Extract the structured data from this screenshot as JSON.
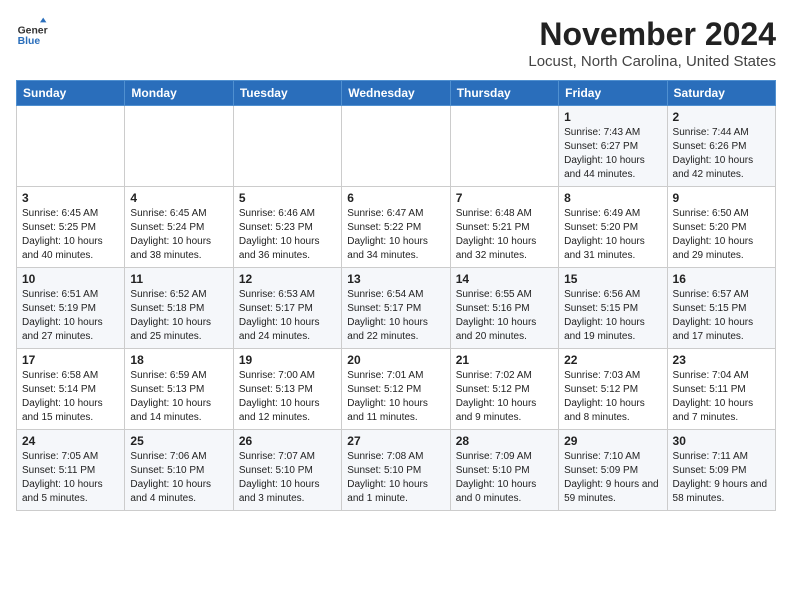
{
  "header": {
    "logo_line1": "General",
    "logo_line2": "Blue",
    "title": "November 2024",
    "subtitle": "Locust, North Carolina, United States"
  },
  "calendar": {
    "days_of_week": [
      "Sunday",
      "Monday",
      "Tuesday",
      "Wednesday",
      "Thursday",
      "Friday",
      "Saturday"
    ],
    "weeks": [
      [
        {
          "day": "",
          "detail": ""
        },
        {
          "day": "",
          "detail": ""
        },
        {
          "day": "",
          "detail": ""
        },
        {
          "day": "",
          "detail": ""
        },
        {
          "day": "",
          "detail": ""
        },
        {
          "day": "1",
          "detail": "Sunrise: 7:43 AM\nSunset: 6:27 PM\nDaylight: 10 hours and 44 minutes."
        },
        {
          "day": "2",
          "detail": "Sunrise: 7:44 AM\nSunset: 6:26 PM\nDaylight: 10 hours and 42 minutes."
        }
      ],
      [
        {
          "day": "3",
          "detail": "Sunrise: 6:45 AM\nSunset: 5:25 PM\nDaylight: 10 hours and 40 minutes."
        },
        {
          "day": "4",
          "detail": "Sunrise: 6:45 AM\nSunset: 5:24 PM\nDaylight: 10 hours and 38 minutes."
        },
        {
          "day": "5",
          "detail": "Sunrise: 6:46 AM\nSunset: 5:23 PM\nDaylight: 10 hours and 36 minutes."
        },
        {
          "day": "6",
          "detail": "Sunrise: 6:47 AM\nSunset: 5:22 PM\nDaylight: 10 hours and 34 minutes."
        },
        {
          "day": "7",
          "detail": "Sunrise: 6:48 AM\nSunset: 5:21 PM\nDaylight: 10 hours and 32 minutes."
        },
        {
          "day": "8",
          "detail": "Sunrise: 6:49 AM\nSunset: 5:20 PM\nDaylight: 10 hours and 31 minutes."
        },
        {
          "day": "9",
          "detail": "Sunrise: 6:50 AM\nSunset: 5:20 PM\nDaylight: 10 hours and 29 minutes."
        }
      ],
      [
        {
          "day": "10",
          "detail": "Sunrise: 6:51 AM\nSunset: 5:19 PM\nDaylight: 10 hours and 27 minutes."
        },
        {
          "day": "11",
          "detail": "Sunrise: 6:52 AM\nSunset: 5:18 PM\nDaylight: 10 hours and 25 minutes."
        },
        {
          "day": "12",
          "detail": "Sunrise: 6:53 AM\nSunset: 5:17 PM\nDaylight: 10 hours and 24 minutes."
        },
        {
          "day": "13",
          "detail": "Sunrise: 6:54 AM\nSunset: 5:17 PM\nDaylight: 10 hours and 22 minutes."
        },
        {
          "day": "14",
          "detail": "Sunrise: 6:55 AM\nSunset: 5:16 PM\nDaylight: 10 hours and 20 minutes."
        },
        {
          "day": "15",
          "detail": "Sunrise: 6:56 AM\nSunset: 5:15 PM\nDaylight: 10 hours and 19 minutes."
        },
        {
          "day": "16",
          "detail": "Sunrise: 6:57 AM\nSunset: 5:15 PM\nDaylight: 10 hours and 17 minutes."
        }
      ],
      [
        {
          "day": "17",
          "detail": "Sunrise: 6:58 AM\nSunset: 5:14 PM\nDaylight: 10 hours and 15 minutes."
        },
        {
          "day": "18",
          "detail": "Sunrise: 6:59 AM\nSunset: 5:13 PM\nDaylight: 10 hours and 14 minutes."
        },
        {
          "day": "19",
          "detail": "Sunrise: 7:00 AM\nSunset: 5:13 PM\nDaylight: 10 hours and 12 minutes."
        },
        {
          "day": "20",
          "detail": "Sunrise: 7:01 AM\nSunset: 5:12 PM\nDaylight: 10 hours and 11 minutes."
        },
        {
          "day": "21",
          "detail": "Sunrise: 7:02 AM\nSunset: 5:12 PM\nDaylight: 10 hours and 9 minutes."
        },
        {
          "day": "22",
          "detail": "Sunrise: 7:03 AM\nSunset: 5:12 PM\nDaylight: 10 hours and 8 minutes."
        },
        {
          "day": "23",
          "detail": "Sunrise: 7:04 AM\nSunset: 5:11 PM\nDaylight: 10 hours and 7 minutes."
        }
      ],
      [
        {
          "day": "24",
          "detail": "Sunrise: 7:05 AM\nSunset: 5:11 PM\nDaylight: 10 hours and 5 minutes."
        },
        {
          "day": "25",
          "detail": "Sunrise: 7:06 AM\nSunset: 5:10 PM\nDaylight: 10 hours and 4 minutes."
        },
        {
          "day": "26",
          "detail": "Sunrise: 7:07 AM\nSunset: 5:10 PM\nDaylight: 10 hours and 3 minutes."
        },
        {
          "day": "27",
          "detail": "Sunrise: 7:08 AM\nSunset: 5:10 PM\nDaylight: 10 hours and 1 minute."
        },
        {
          "day": "28",
          "detail": "Sunrise: 7:09 AM\nSunset: 5:10 PM\nDaylight: 10 hours and 0 minutes."
        },
        {
          "day": "29",
          "detail": "Sunrise: 7:10 AM\nSunset: 5:09 PM\nDaylight: 9 hours and 59 minutes."
        },
        {
          "day": "30",
          "detail": "Sunrise: 7:11 AM\nSunset: 5:09 PM\nDaylight: 9 hours and 58 minutes."
        }
      ]
    ]
  }
}
